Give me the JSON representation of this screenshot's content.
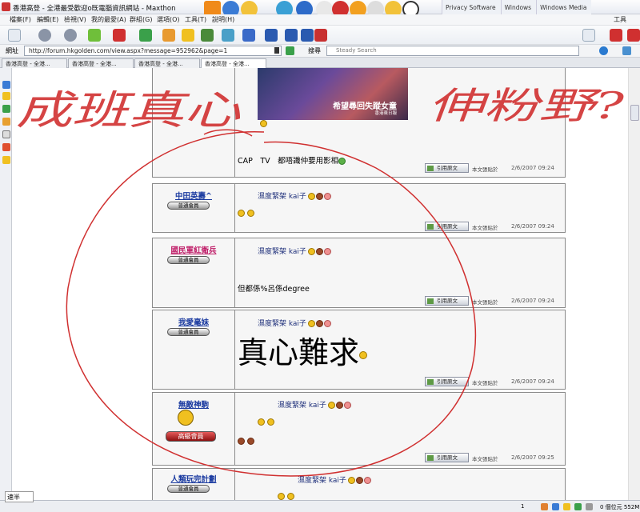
{
  "window": {
    "title": "香港高登 - 全港最受歡迎o既電腦資訊網站 - Maxthon",
    "titlebar_tabs": [
      "Privacy Software",
      "Windows",
      "Windows Media"
    ]
  },
  "menu": [
    "檔案(F)",
    "編輯(E)",
    "檢視(V)",
    "我的最愛(A)",
    "群組(G)",
    "選項(O)",
    "工具(T)",
    "說明(H)",
    "工具"
  ],
  "address": {
    "label": "網址",
    "url": "http://forum.hkgolden.com/view.aspx?message=952962&page=1",
    "search_label": "搜尋",
    "search_placeholder": "Steady Search"
  },
  "tabs": [
    "香港高登 - 全港...",
    "香港高登 - 全港...",
    "香港高登 - 全港...",
    "香港高登 - 全港..."
  ],
  "posts": [
    {
      "user": "",
      "rank": "",
      "title": "",
      "body": "CAP　TV　都唔識仲要用影相",
      "quote": "引用原文",
      "link": "本文張貼於",
      "date": "2/6/2007 09:24",
      "image_caption": "希望尋回失蹤女童",
      "image_sub": "香港東日報"
    },
    {
      "user": "中田英壽^",
      "rank": "普通會員",
      "title": "濕度緊架 kai子",
      "body": "",
      "quote": "引用原文",
      "link": "本文張貼於",
      "date": "2/6/2007 09:24"
    },
    {
      "user": "國民軍紅衛兵",
      "rank": "普通會員",
      "title": "濕度緊架 kai子",
      "body": "但都係%呂係degree",
      "quote": "引用原文",
      "link": "本文張貼於",
      "date": "2/6/2007 09:24"
    },
    {
      "user": "我愛毫妹",
      "rank": "普通會員",
      "title": "濕度緊架 kai子",
      "body": "真心難求",
      "quote": "引用原文",
      "link": "本文張貼於",
      "date": "2/6/2007 09:24"
    },
    {
      "user": "無敵神駒",
      "rank": "高級會員",
      "title": "濕度緊架 kai子",
      "body": "",
      "quote": "引用原文",
      "link": "本文張貼於",
      "date": "2/6/2007 09:25"
    },
    {
      "user": "人類玩完計劃",
      "rank": "普通會員",
      "title": "濕度緊架 kai子",
      "body": "",
      "quote": "",
      "link": "",
      "date": ""
    }
  ],
  "handwriting": {
    "left": "成班真心",
    "right": "伸粉野?",
    "color": "#d03030"
  },
  "status": {
    "ime": "速半",
    "count": "1",
    "right": "0 個位元 552M"
  }
}
